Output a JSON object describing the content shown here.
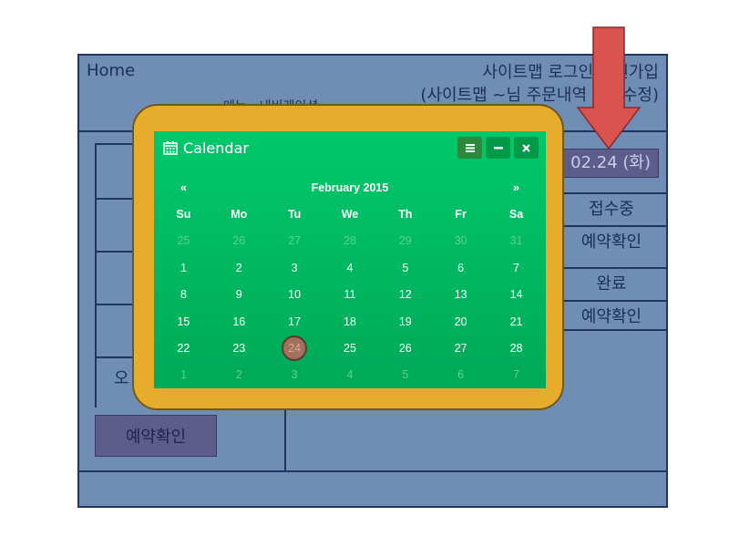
{
  "header": {
    "home": "Home",
    "nav_line1": "사이트맵 로그인 회원가입",
    "nav_line2": "(사이트맵 ~님  주문내역 정보수정)",
    "menu": "메뉴 - 내비게이션"
  },
  "left_panel": {
    "partial_label": "오",
    "button": "예약확인"
  },
  "right_panel": {
    "date_button": "02.24 (화)",
    "statuses": [
      "접수중",
      "예약확인",
      "완료",
      "예약확인"
    ]
  },
  "calendar": {
    "title": "Calendar",
    "icons": [
      "calendar-icon",
      "menu-icon",
      "minimize-icon",
      "close-icon"
    ],
    "prev": "«",
    "month_label": "February 2015",
    "next": "»",
    "weekdays": [
      "Su",
      "Mo",
      "Tu",
      "We",
      "Th",
      "Fr",
      "Sa"
    ],
    "weeks": [
      [
        "25",
        "26",
        "27",
        "28",
        "29",
        "30",
        "31"
      ],
      [
        "1",
        "2",
        "3",
        "4",
        "5",
        "6",
        "7"
      ],
      [
        "8",
        "9",
        "10",
        "11",
        "12",
        "13",
        "14"
      ],
      [
        "15",
        "16",
        "17",
        "18",
        "19",
        "20",
        "21"
      ],
      [
        "22",
        "23",
        "24",
        "25",
        "26",
        "27",
        "28"
      ],
      [
        "1",
        "2",
        "3",
        "4",
        "5",
        "6",
        "7"
      ]
    ],
    "selected_day": "24"
  },
  "colors": {
    "page_bg": "#6f8db5",
    "border": "#1d3560",
    "popup_frame": "#e8ac2c",
    "calendar_bg": "#00b862",
    "arrow": "#d9534f",
    "button_bg": "#5e5c8a"
  }
}
